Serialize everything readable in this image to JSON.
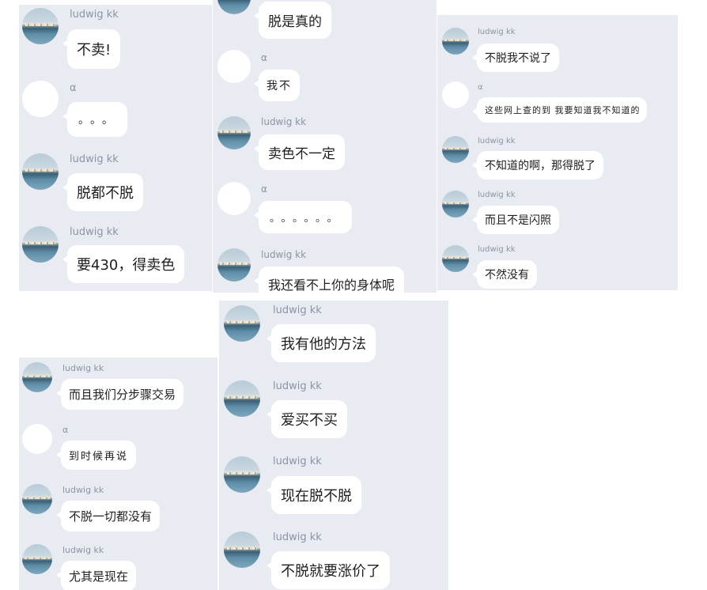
{
  "panels": {
    "p1": {
      "messages": [
        {
          "name": "ludwig kk",
          "text": "不卖!"
        },
        {
          "name": "α",
          "text": "。。。"
        },
        {
          "name": "ludwig kk",
          "text": "脱都不脱"
        },
        {
          "name": "ludwig kk",
          "text": "要430，得卖色"
        }
      ]
    },
    "p2": {
      "messages": [
        {
          "name": "",
          "text": "脱是真的"
        },
        {
          "name": "α",
          "text": "我不"
        },
        {
          "name": "ludwig kk",
          "text": "卖色不一定"
        },
        {
          "name": "α",
          "text": "。。。。。。"
        },
        {
          "name": "ludwig kk",
          "text": "我还看不上你的身体呢"
        }
      ]
    },
    "p3": {
      "messages": [
        {
          "name": "ludwig kk",
          "text": "不脱我不说了"
        },
        {
          "name": "α",
          "text": "这些网上查的到 我要知道我不知道的"
        },
        {
          "name": "ludwig kk",
          "text": "不知道的啊，那得脱了"
        },
        {
          "name": "ludwig kk",
          "text": "而且不是闪照"
        },
        {
          "name": "ludwig kk",
          "text": "不然没有"
        }
      ]
    },
    "p4": {
      "messages": [
        {
          "name": "ludwig kk",
          "text": "而且我们分步骤交易"
        },
        {
          "name": "α",
          "text": "到时候再说"
        },
        {
          "name": "ludwig kk",
          "text": "不脱一切都没有"
        },
        {
          "name": "ludwig kk",
          "text": "尤其是现在"
        }
      ]
    },
    "p5": {
      "messages": [
        {
          "name": "ludwig kk",
          "text": "我有他的方法"
        },
        {
          "name": "ludwig kk",
          "text": "爱买不买"
        },
        {
          "name": "ludwig kk",
          "text": "现在脱不脱"
        },
        {
          "name": "ludwig kk",
          "text": "不脱就要涨价了"
        }
      ]
    }
  },
  "colors": {
    "panel_bg": "#e9ebf2",
    "bubble_bg": "#ffffff",
    "name_text": "#8d93a3",
    "message_text": "#1f1f1f"
  },
  "icons": {
    "ludwig_avatar": "seaside-town-avatar-icon",
    "alpha_avatar": "blank-white-avatar-icon"
  }
}
